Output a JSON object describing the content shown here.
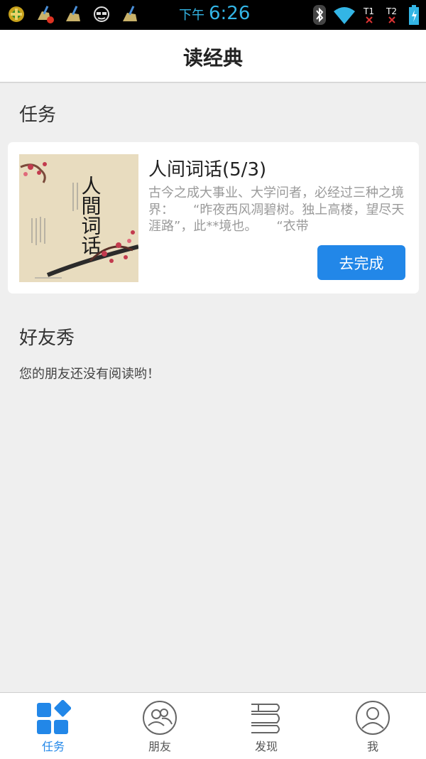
{
  "status_bar": {
    "ampm": "下午",
    "time": "6:26"
  },
  "header": {
    "title": "读经典"
  },
  "tasks": {
    "section_title": "任务",
    "item": {
      "title": "人间词话(5/3)",
      "description": "古今之成大事业、大学问者，必经过三种之境界：　　“昨夜西风凋碧树。独上高楼，望尽天涯路”，此**境也。　　“衣带",
      "cover_title": "人間词话",
      "action_label": "去完成"
    }
  },
  "friends": {
    "section_title": "好友秀",
    "empty_message": "您的朋友还没有阅读哟！"
  },
  "tabs": [
    {
      "label": "任务",
      "icon": "tasks-grid-icon",
      "active": true
    },
    {
      "label": "朋友",
      "icon": "friends-icon",
      "active": false
    },
    {
      "label": "发现",
      "icon": "books-icon",
      "active": false
    },
    {
      "label": "我",
      "icon": "profile-icon",
      "active": false
    }
  ],
  "colors": {
    "accent": "#2287e8",
    "status_time": "#33b5e5",
    "background": "#efefef"
  }
}
